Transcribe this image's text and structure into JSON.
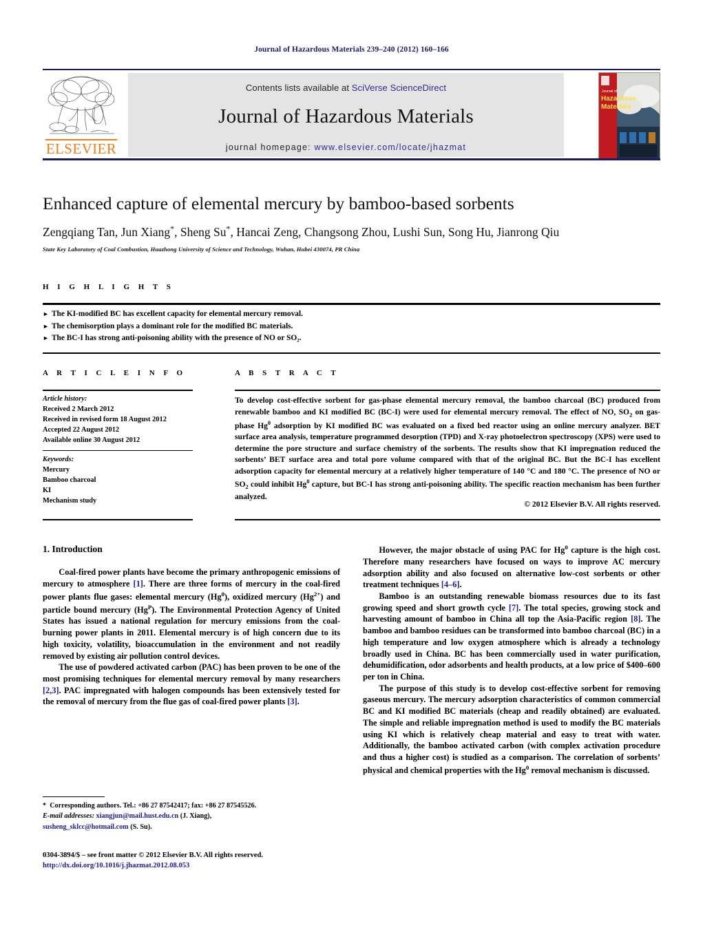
{
  "running_head": "Journal of Hazardous Materials 239–240 (2012) 160–166",
  "masthead": {
    "publisher_logo_text": "ELSEVIER",
    "contents_prefix": "Contents lists available at ",
    "contents_link": "SciVerse ScienceDirect",
    "journal_title": "Journal of Hazardous Materials",
    "homepage_prefix": "journal homepage: ",
    "homepage_url": "www.elsevier.com/locate/jhazmat",
    "cover_title_line1": "Journal of",
    "cover_title_line2": "Hazardous",
    "cover_title_line3": "Materials",
    "link_color": "#2b2b8f",
    "band_color": "#e4e4e4",
    "rule_color": "#1b1b62",
    "elsevier_orange": "#ef7d1a"
  },
  "article": {
    "title": "Enhanced capture of elemental mercury by bamboo-based sorbents",
    "authors_html": "Zengqiang Tan, Jun Xiang<sup>*</sup>, Sheng Su<sup>*</sup>, Hancai Zeng, Changsong Zhou, Lushi Sun, Song Hu, Jianrong Qiu",
    "affiliation": "State Key Laboratory of Coal Combustion, Huazhong University of Science and Technology, Wuhan, Hubei 430074, PR China"
  },
  "highlights": {
    "label": "H I G H L I G H T S",
    "items": [
      "The KI-modified BC has excellent capacity for elemental mercury removal.",
      "The chemisorption plays a dominant role for the modified BC materials.",
      "The BC-I has strong anti-poisoning ability with the presence of NO or SO₂."
    ]
  },
  "article_info": {
    "label": "A R T I C L E   I N F O",
    "history_label": "Article history:",
    "history": [
      "Received 2 March 2012",
      "Received in revised form 18 August 2012",
      "Accepted 22 August 2012",
      "Available online 30 August 2012"
    ],
    "keywords_label": "Keywords:",
    "keywords": [
      "Mercury",
      "Bamboo charcoal",
      "KI",
      "Mechanism study"
    ]
  },
  "abstract": {
    "label": "A B S T R A C T",
    "text_html": "To develop cost-effective sorbent for gas-phase elemental mercury removal, the bamboo charcoal (BC) produced from renewable bamboo and KI modified BC (BC-I) were used for elemental mercury removal. The effect of NO, SO<sub>2</sub> on gas-phase Hg<sup>0</sup> adsorption by KI modified BC was evaluated on a fixed bed reactor using an online mercury analyzer. BET surface area analysis, temperature programmed desorption (TPD) and X-ray photoelectron spectroscopy (XPS) were used to determine the pore structure and surface chemistry of the sorbents. The results show that KI impregnation reduced the sorbents’ BET surface area and total pore volume compared with that of the original BC. But the BC-I has excellent adsorption capacity for elemental mercury at a relatively higher temperature of 140 °C and 180 °C. The presence of NO or SO<sub>2</sub> could inhibit Hg<sup>0</sup> capture, but BC-I has strong anti-poisoning ability. The specific reaction mechanism has been further analyzed.",
    "copyright": "© 2012 Elsevier B.V. All rights reserved."
  },
  "body": {
    "section_heading": "1.  Introduction",
    "left_paragraphs_html": [
      "Coal-fired power plants have become the primary anthropogenic emissions of mercury to atmosphere <span class=\"ref\">[1]</span>. There are three forms of mercury in the coal-fired power plants flue gases: elemental mercury (Hg<sup>0</sup>), oxidized mercury (Hg<sup>2+</sup>) and particle bound mercury (Hg<sup>P</sup>). The Environmental Protection Agency of United States has issued a national regulation for mercury emissions from the coal-burning power plants in 2011. Elemental mercury is of high concern due to its high toxicity, volatility, bioaccumulation in the environment and not readily removed by existing air pollution control devices.",
      "The use of powdered activated carbon (PAC) has been proven to be one of the most promising techniques for elemental mercury removal by many researchers <span class=\"ref\">[2,3]</span>. PAC impregnated with halogen compounds has been extensively tested for the removal of mercury from the flue gas of coal-fired power plants <span class=\"ref\">[3]</span>."
    ],
    "right_paragraphs_html": [
      "However, the major obstacle of using PAC for Hg<sup>0</sup> capture is the high cost. Therefore many researchers have focused on ways to improve AC mercury adsorption ability and also focused on alternative low-cost sorbents or other treatment techniques <span class=\"ref\">[4–6]</span>.",
      "Bamboo is an outstanding renewable biomass resources due to its fast growing speed and short growth cycle <span class=\"ref\">[7]</span>. The total species, growing stock and harvesting amount of bamboo in China all top the Asia-Pacific region <span class=\"ref\">[8]</span>. The bamboo and bamboo residues can be transformed into bamboo charcoal (BC) in a high temperature and low oxygen atmosphere which is already a technology broadly used in China. BC has been commercially used in water purification, dehumidification, odor adsorbents and health products, at a low price of $400–600 per ton in China.",
      "The purpose of this study is to develop cost-effective sorbent for removing gaseous mercury. The mercury adsorption characteristics of common commercial BC and KI modified BC materials (cheap and readily obtained) are evaluated. The simple and reliable impregnation method is used to modify the BC materials using KI which is relatively cheap material and easy to treat with water. Additionally, the bamboo activated carbon (with complex activation procedure and thus a higher cost) is studied as a comparison. The correlation of sorbents’ physical and chemical properties with the Hg<sup>0</sup> removal mechanism is discussed."
    ]
  },
  "footnotes": {
    "corresponding_html": "<span class=\"ind\">*&nbsp; Corresponding authors. Tel.: +86 27 87542417; fax: +86 27 87545526.</span>",
    "email_html": "<span class=\"ind\"><span class=\"ital\">E-mail addresses:</span> <span class=\"mail\">xiangjun@mail.hust.edu.cn</span> (J. Xiang),</span>",
    "email2_html": "<span class=\"mail\">susheng_sklcc@hotmail.com</span> (S. Su).",
    "issn_line": "0304-3894/$ – see front matter © 2012 Elsevier B.V. All rights reserved.",
    "doi_line": "http://dx.doi.org/10.1016/j.jhazmat.2012.08.053"
  }
}
